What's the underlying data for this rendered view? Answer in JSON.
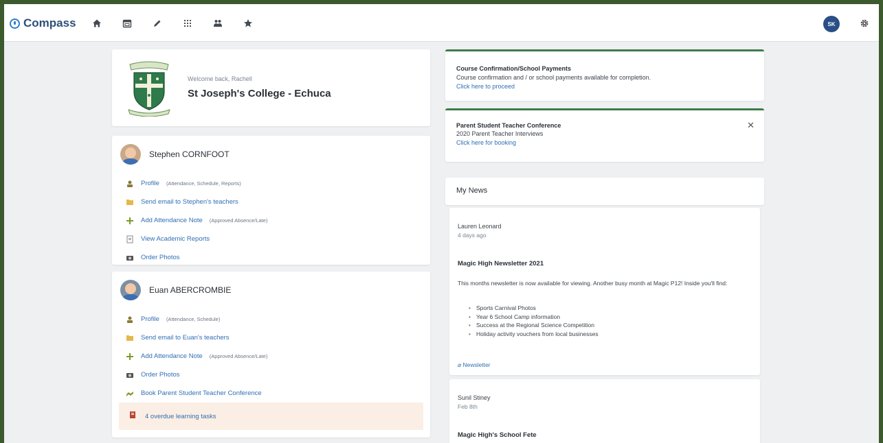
{
  "app": {
    "name": "Compass",
    "user_initials": "SK"
  },
  "nav": [
    "home-icon",
    "calendar-icon",
    "pencil-icon",
    "grid-icon",
    "people-icon",
    "star-icon"
  ],
  "welcome": {
    "greeting": "Welcome back, Rachell",
    "school": "St Joseph's College - Echuca"
  },
  "students": [
    {
      "name": "Stephen CORNFOOT",
      "links": [
        {
          "label": "Profile",
          "sub": "(Attendance, Schedule, Reports)"
        },
        {
          "label": "Send email to Stephen's teachers",
          "sub": ""
        },
        {
          "label": "Add Attendance Note",
          "sub": "(Approved Absence/Late)"
        },
        {
          "label": "View Academic Reports",
          "sub": ""
        },
        {
          "label": "Order Photos",
          "sub": ""
        }
      ]
    },
    {
      "name": "Euan ABERCROMBIE",
      "links": [
        {
          "label": "Profile",
          "sub": "(Attendance, Schedule)"
        },
        {
          "label": "Send email to Euan's teachers",
          "sub": ""
        },
        {
          "label": "Add Attendance Note",
          "sub": "(Approved Absence/Late)"
        },
        {
          "label": "Order Photos",
          "sub": ""
        },
        {
          "label": "Book Parent Student Teacher Conference",
          "sub": ""
        }
      ],
      "tasks": "4 overdue learning tasks"
    }
  ],
  "notices": [
    {
      "title": "Course Confirmation/School Payments",
      "body": "Course confirmation and / or school payments available for completion.",
      "link": "Click here to proceed"
    },
    {
      "title": "Parent Student Teacher Conference",
      "body": "2020 Parent Teacher Interviews",
      "link": "Click here for booking"
    }
  ],
  "news_header": "My News",
  "news": [
    {
      "author": "Lauren Leonard",
      "date": "4 days ago",
      "title": "Magic High Newsletter 2021",
      "body": "This months newsletter is now available for viewing. Another busy month at Magic P12! Inside you'll find:",
      "items": [
        "Sports Carnival Photos",
        "Year 6 School Camp information",
        "Success at the Regional Science Competition",
        "Holiday activity vouchers from local businesses"
      ],
      "attachment": "Newsletter"
    },
    {
      "author": "Sunil Stiney",
      "date": "Feb 8th",
      "title": "Magic High's School Fete"
    }
  ],
  "colors": {
    "accent_green": "#3e7c4a",
    "link_blue": "#2f6fb3",
    "avatar_blue": "#2a4e86"
  }
}
